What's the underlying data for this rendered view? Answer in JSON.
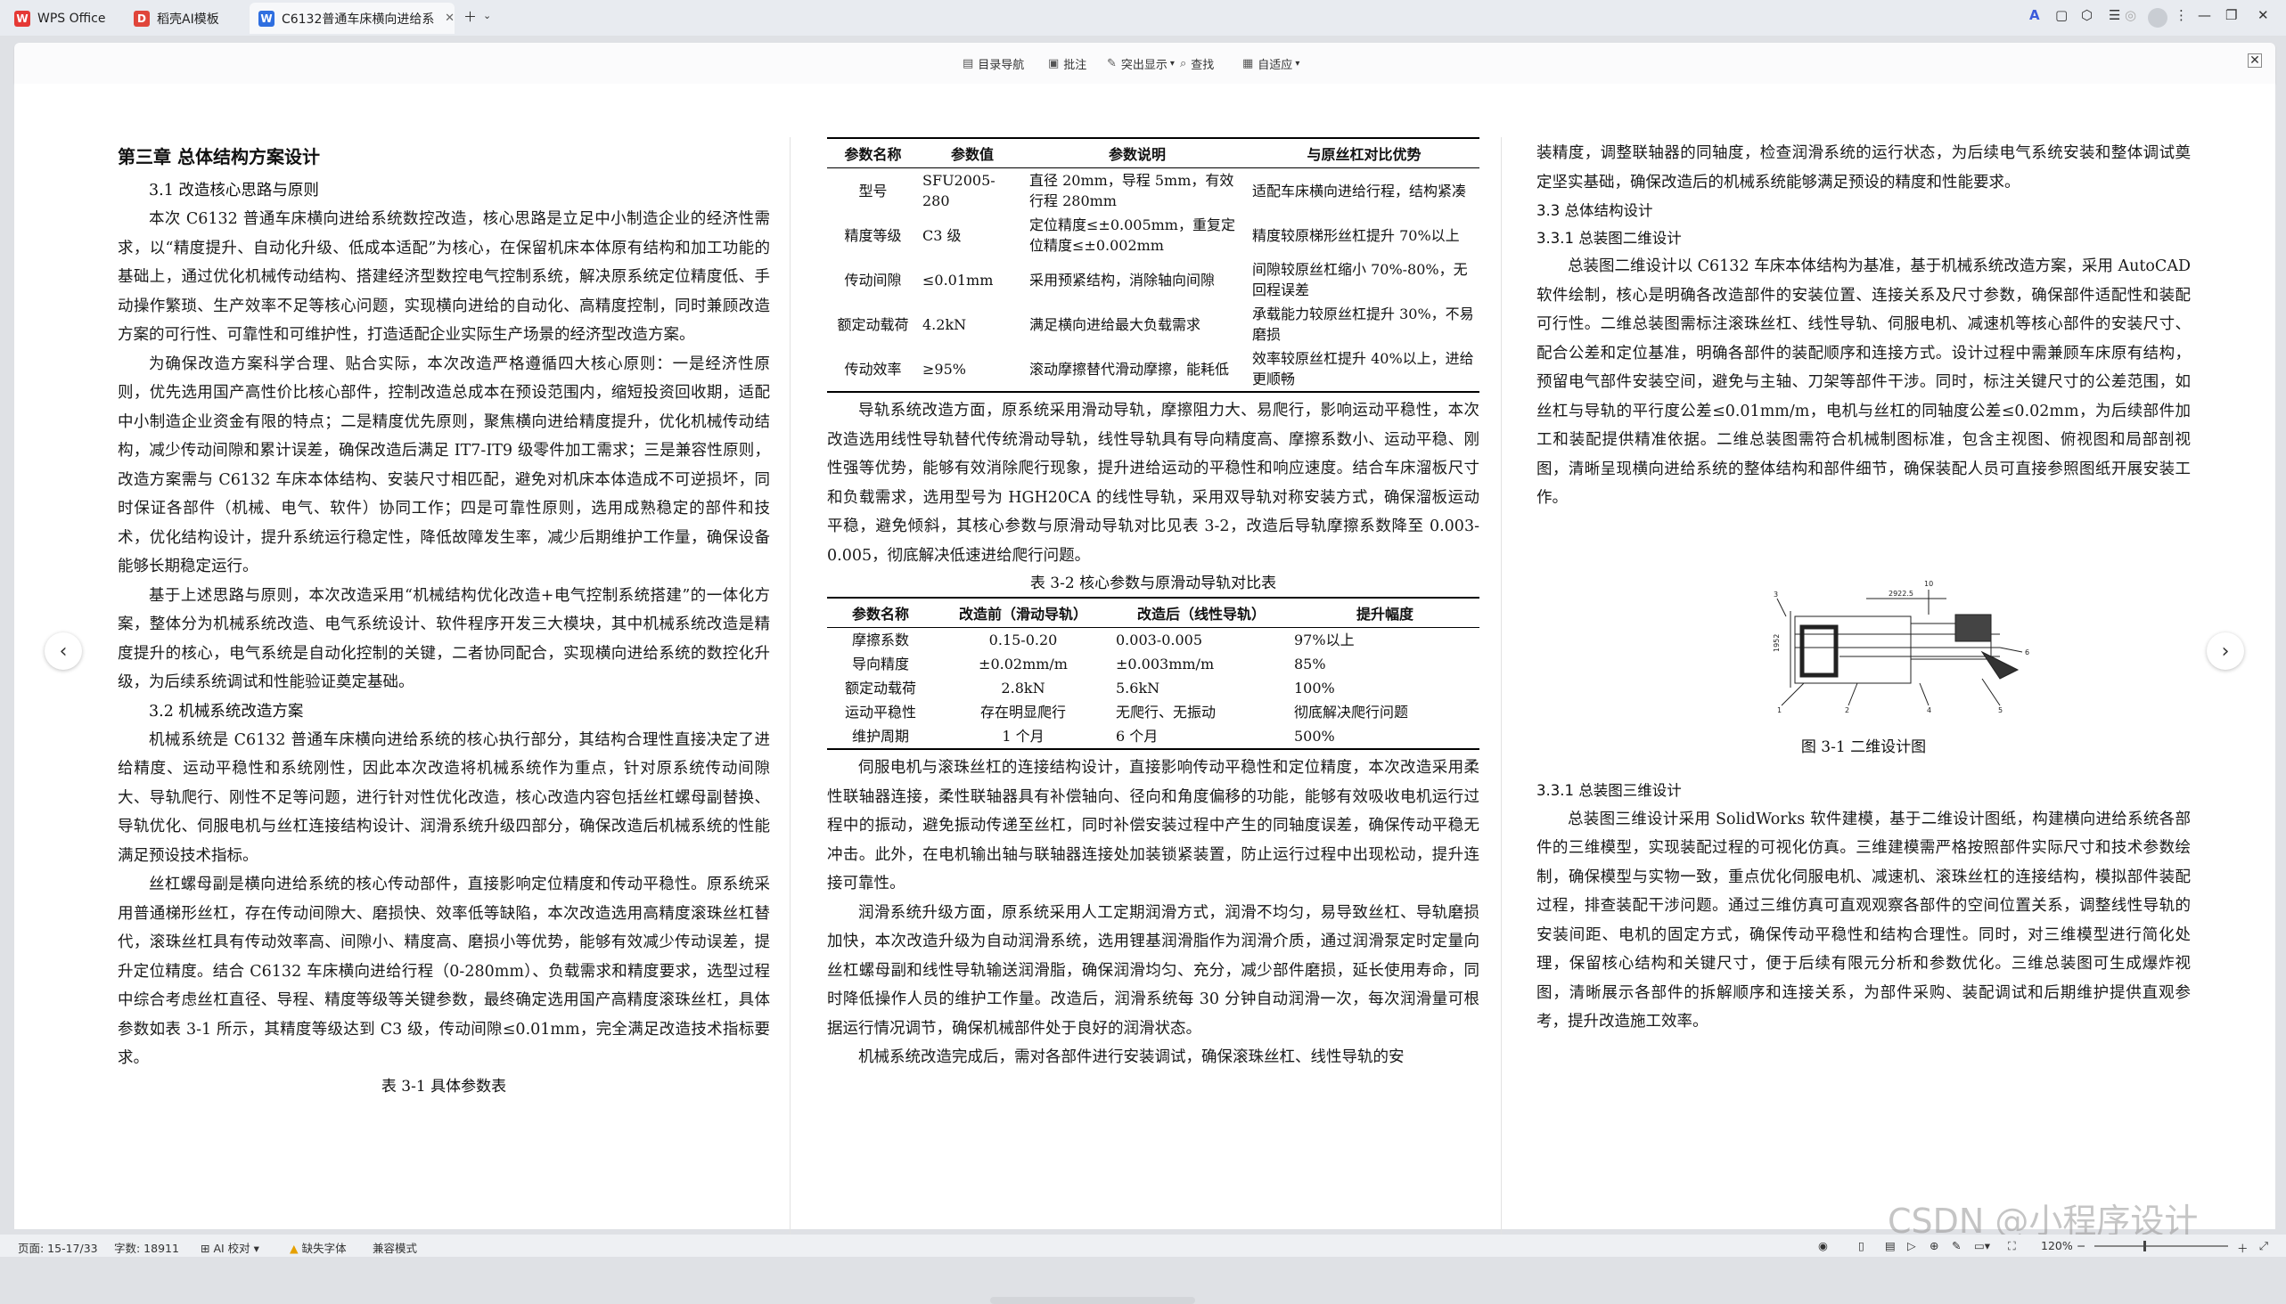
{
  "tabs": [
    {
      "icon": "wps-logo-icon",
      "label": "WPS Office"
    },
    {
      "icon": "ai-template-icon",
      "label": "稻壳AI模板"
    },
    {
      "icon": "word-doc-icon",
      "label": "C6132普通车床横向进给系"
    }
  ],
  "toolbar": {
    "nav": "目录导航",
    "comment": "批注",
    "highlight": "突出显示",
    "find": "查找",
    "fit": "自适应"
  },
  "left": {
    "chapter": "第三章  总体结构方案设计",
    "s31": "3.1  改造核心思路与原则",
    "p1": "本次 C6132 普通车床横向进给系统数控改造，核心思路是立足中小制造企业的经济性需求，以“精度提升、自动化升级、低成本适配”为核心，在保留机床本体原有结构和加工功能的基础上，通过优化机械传动结构、搭建经济型数控电气控制系统，解决原系统定位精度低、手动操作繁琐、生产效率不足等核心问题，实现横向进给的自动化、高精度控制，同时兼顾改造方案的可行性、可靠性和可维护性，打造适配企业实际生产场景的经济型改造方案。",
    "p2": "为确保改造方案科学合理、贴合实际，本次改造严格遵循四大核心原则：一是经济性原则，优先选用国产高性价比核心部件，控制改造总成本在预设范围内，缩短投资回收期，适配中小制造企业资金有限的特点；二是精度优先原则，聚焦横向进给精度提升，优化机械传动结构，减少传动间隙和累计误差，确保改造后满足 IT7-IT9 级零件加工需求；三是兼容性原则，改造方案需与 C6132 车床本体结构、安装尺寸相匹配，避免对机床本体造成不可逆损坏，同时保证各部件（机械、电气、软件）协同工作；四是可靠性原则，选用成熟稳定的部件和技术，优化结构设计，提升系统运行稳定性，降低故障发生率，减少后期维护工作量，确保设备能够长期稳定运行。",
    "p3": "基于上述思路与原则，本次改造采用“机械结构优化改造+电气控制系统搭建”的一体化方案，整体分为机械系统改造、电气系统设计、软件程序开发三大模块，其中机械系统改造是精度提升的核心，电气系统是自动化控制的关键，二者协同配合，实现横向进给系统的数控化升级，为后续系统调试和性能验证奠定基础。",
    "s32": "3.2  机械系统改造方案",
    "p4": "机械系统是 C6132 普通车床横向进给系统的核心执行部分，其结构合理性直接决定了进给精度、运动平稳性和系统刚性，因此本次改造将机械系统作为重点，针对原系统传动间隙大、导轨爬行、刚性不足等问题，进行针对性优化改造，核心改造内容包括丝杠螺母副替换、导轨优化、伺服电机与丝杠连接结构设计、润滑系统升级四部分，确保改造后机械系统的性能满足预设技术指标。",
    "p5": "丝杠螺母副是横向进给系统的核心传动部件，直接影响定位精度和传动平稳性。原系统采用普通梯形丝杠，存在传动间隙大、磨损快、效率低等缺陷，本次改造选用高精度滚珠丝杠替代，滚珠丝杠具有传动效率高、间隙小、精度高、磨损小等优势，能够有效减少传动误差，提升定位精度。结合 C6132 车床横向进给行程（0-280mm）、负载需求和精度要求，选型过程中综合考虑丝杠直径、导程、精度等级等关键参数，最终确定选用国产高精度滚珠丝杠，具体参数如表 3-1 所示，其精度等级达到 C3 级，传动间隙≤0.01mm，完全满足改造技术指标要求。",
    "t31_caption": "表 3-1 具体参数表"
  },
  "middle": {
    "table1": {
      "headers": [
        "参数名称",
        "参数值",
        "参数说明",
        "与原丝杠对比优势"
      ],
      "rows": [
        [
          "型号",
          "SFU2005-280",
          "直径 20mm，导程 5mm，有效行程 280mm",
          "适配车床横向进给行程，结构紧凑"
        ],
        [
          "精度等级",
          "C3 级",
          "定位精度≤±0.005mm，重复定位精度≤±0.002mm",
          "精度较原梯形丝杠提升 70%以上"
        ],
        [
          "传动间隙",
          "≤0.01mm",
          "采用预紧结构，消除轴向间隙",
          "间隙较原丝杠缩小 70%-80%，无回程误差"
        ],
        [
          "额定动载荷",
          "4.2kN",
          "满足横向进给最大负载需求",
          "承载能力较原丝杠提升 30%，不易磨损"
        ],
        [
          "传动效率",
          "≥95%",
          "滚动摩擦替代滑动摩擦，能耗低",
          "效率较原丝杠提升 40%以上，进给更顺畅"
        ]
      ]
    },
    "p1": "导轨系统改造方面，原系统采用滑动导轨，摩擦阻力大、易爬行，影响运动平稳性，本次改造选用线性导轨替代传统滑动导轨，线性导轨具有导向精度高、摩擦系数小、运动平稳、刚性强等优势，能够有效消除爬行现象，提升进给运动的平稳性和响应速度。结合车床溜板尺寸和负载需求，选用型号为 HGH20CA 的线性导轨，采用双导轨对称安装方式，确保溜板运动平稳，避免倾斜，其核心参数与原滑动导轨对比见表 3-2，改造后导轨摩擦系数降至 0.003-0.005，彻底解决低速进给爬行问题。",
    "t32_caption": "表 3-2 核心参数与原滑动导轨对比表",
    "table2": {
      "headers": [
        "参数名称",
        "改造前（滑动导轨）",
        "改造后（线性导轨）",
        "提升幅度"
      ],
      "rows": [
        [
          "摩擦系数",
          "0.15-0.20",
          "0.003-0.005",
          "97%以上"
        ],
        [
          "导向精度",
          "±0.02mm/m",
          "±0.003mm/m",
          "85%"
        ],
        [
          "额定动载荷",
          "2.8kN",
          "5.6kN",
          "100%"
        ],
        [
          "运动平稳性",
          "存在明显爬行",
          "无爬行、无振动",
          "彻底解决爬行问题"
        ],
        [
          "维护周期",
          "1 个月",
          "6 个月",
          "500%"
        ]
      ]
    },
    "p2": "伺服电机与滚珠丝杠的连接结构设计，直接影响传动平稳性和定位精度，本次改造采用柔性联轴器连接，柔性联轴器具有补偿轴向、径向和角度偏移的功能，能够有效吸收电机运行过程中的振动，避免振动传递至丝杠，同时补偿安装过程中产生的同轴度误差，确保传动平稳无冲击。此外，在电机输出轴与联轴器连接处加装锁紧装置，防止运行过程中出现松动，提升连接可靠性。",
    "p3": "润滑系统升级方面，原系统采用人工定期润滑方式，润滑不均匀，易导致丝杠、导轨磨损加快，本次改造升级为自动润滑系统，选用锂基润滑脂作为润滑介质，通过润滑泵定时定量向丝杠螺母副和线性导轨输送润滑脂，确保润滑均匀、充分，减少部件磨损，延长使用寿命，同时降低操作人员的维护工作量。改造后，润滑系统每 30 分钟自动润滑一次，每次润滑量可根据运行情况调节，确保机械部件处于良好的润滑状态。",
    "p4": "机械系统改造完成后，需对各部件进行安装调试，确保滚珠丝杠、线性导轨的安"
  },
  "right": {
    "p0": "装精度，调整联轴器的同轴度，检查润滑系统的运行状态，为后续电气系统安装和整体调试奠定坚实基础，确保改造后的机械系统能够满足预设的精度和性能要求。",
    "s33": "3.3  总体结构设计",
    "s331": "3.3.1  总装图二维设计",
    "p1": "总装图二维设计以 C6132 车床本体结构为基准，基于机械系统改造方案，采用 AutoCAD 软件绘制，核心是明确各改造部件的安装位置、连接关系及尺寸参数，确保部件适配性和装配可行性。二维总装图需标注滚珠丝杠、线性导轨、伺服电机、减速机等核心部件的安装尺寸、配合公差和定位基准，明确各部件的装配顺序和连接方式。设计过程中需兼顾车床原有结构，预留电气部件安装空间，避免与主轴、刀架等部件干涉。同时，标注关键尺寸的公差范围，如丝杠与导轨的平行度公差≤0.01mm/m，电机与丝杠的同轴度公差≤0.02mm，为后续部件加工和装配提供精准依据。二维总装图需符合机械制图标准，包含主视图、俯视图和局部剖视图，清晰呈现横向进给系统的整体结构和部件细节，确保装配人员可直接参照图纸开展安装工作。",
    "drawing_labels": [
      "10",
      "2922.5",
      "1952",
      "3",
      "1",
      "2",
      "4",
      "5",
      "6"
    ],
    "fig31_caption": "图 3-1  二维设计图",
    "s332": "3.3.1  总装图三维设计",
    "p2": "总装图三维设计采用 SolidWorks 软件建模，基于二维设计图纸，构建横向进给系统各部件的三维模型，实现装配过程的可视化仿真。三维建模需严格按照部件实际尺寸和技术参数绘制，确保模型与实物一致，重点优化伺服电机、减速机、滚珠丝杠的连接结构，模拟部件装配过程，排查装配干涉问题。通过三维仿真可直观观察各部件的空间位置关系，调整线性导轨的安装间距、电机的固定方式，确保传动平稳性和结构合理性。同时，对三维模型进行简化处理，保留核心结构和关键尺寸，便于后续有限元分析和参数优化。三维总装图可生成爆炸视图，清晰展示各部件的拆解顺序和连接关系，为部件采购、装配调试和后期维护提供直观参考，提升改造施工效率。"
  },
  "status": {
    "page": "页面: 15-17/33",
    "words": "字数: 18911",
    "ai_check": "AI 校对",
    "missing_font": "缺失字体",
    "compat": "兼容模式",
    "zoom": "120%"
  },
  "watermark": "CSDN @小程序设计"
}
